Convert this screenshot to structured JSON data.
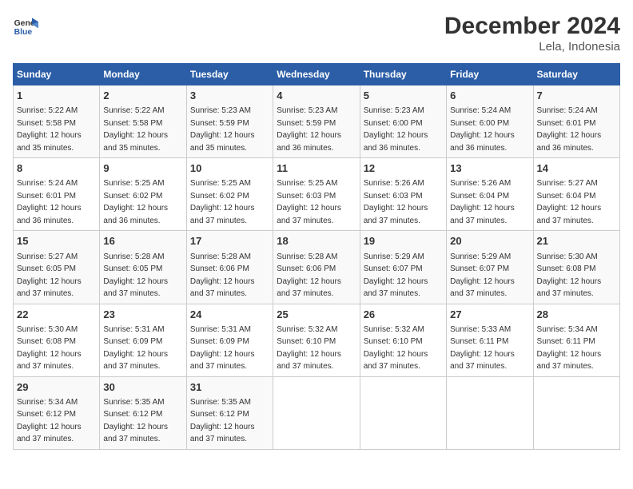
{
  "logo": {
    "line1": "General",
    "line2": "Blue"
  },
  "title": "December 2024",
  "subtitle": "Lela, Indonesia",
  "days_of_week": [
    "Sunday",
    "Monday",
    "Tuesday",
    "Wednesday",
    "Thursday",
    "Friday",
    "Saturday"
  ],
  "weeks": [
    [
      {
        "day": "1",
        "sunrise": "5:22 AM",
        "sunset": "5:58 PM",
        "daylight": "12 hours and 35 minutes."
      },
      {
        "day": "2",
        "sunrise": "5:22 AM",
        "sunset": "5:58 PM",
        "daylight": "12 hours and 35 minutes."
      },
      {
        "day": "3",
        "sunrise": "5:23 AM",
        "sunset": "5:59 PM",
        "daylight": "12 hours and 35 minutes."
      },
      {
        "day": "4",
        "sunrise": "5:23 AM",
        "sunset": "5:59 PM",
        "daylight": "12 hours and 36 minutes."
      },
      {
        "day": "5",
        "sunrise": "5:23 AM",
        "sunset": "6:00 PM",
        "daylight": "12 hours and 36 minutes."
      },
      {
        "day": "6",
        "sunrise": "5:24 AM",
        "sunset": "6:00 PM",
        "daylight": "12 hours and 36 minutes."
      },
      {
        "day": "7",
        "sunrise": "5:24 AM",
        "sunset": "6:01 PM",
        "daylight": "12 hours and 36 minutes."
      }
    ],
    [
      {
        "day": "8",
        "sunrise": "5:24 AM",
        "sunset": "6:01 PM",
        "daylight": "12 hours and 36 minutes."
      },
      {
        "day": "9",
        "sunrise": "5:25 AM",
        "sunset": "6:02 PM",
        "daylight": "12 hours and 36 minutes."
      },
      {
        "day": "10",
        "sunrise": "5:25 AM",
        "sunset": "6:02 PM",
        "daylight": "12 hours and 37 minutes."
      },
      {
        "day": "11",
        "sunrise": "5:25 AM",
        "sunset": "6:03 PM",
        "daylight": "12 hours and 37 minutes."
      },
      {
        "day": "12",
        "sunrise": "5:26 AM",
        "sunset": "6:03 PM",
        "daylight": "12 hours and 37 minutes."
      },
      {
        "day": "13",
        "sunrise": "5:26 AM",
        "sunset": "6:04 PM",
        "daylight": "12 hours and 37 minutes."
      },
      {
        "day": "14",
        "sunrise": "5:27 AM",
        "sunset": "6:04 PM",
        "daylight": "12 hours and 37 minutes."
      }
    ],
    [
      {
        "day": "15",
        "sunrise": "5:27 AM",
        "sunset": "6:05 PM",
        "daylight": "12 hours and 37 minutes."
      },
      {
        "day": "16",
        "sunrise": "5:28 AM",
        "sunset": "6:05 PM",
        "daylight": "12 hours and 37 minutes."
      },
      {
        "day": "17",
        "sunrise": "5:28 AM",
        "sunset": "6:06 PM",
        "daylight": "12 hours and 37 minutes."
      },
      {
        "day": "18",
        "sunrise": "5:28 AM",
        "sunset": "6:06 PM",
        "daylight": "12 hours and 37 minutes."
      },
      {
        "day": "19",
        "sunrise": "5:29 AM",
        "sunset": "6:07 PM",
        "daylight": "12 hours and 37 minutes."
      },
      {
        "day": "20",
        "sunrise": "5:29 AM",
        "sunset": "6:07 PM",
        "daylight": "12 hours and 37 minutes."
      },
      {
        "day": "21",
        "sunrise": "5:30 AM",
        "sunset": "6:08 PM",
        "daylight": "12 hours and 37 minutes."
      }
    ],
    [
      {
        "day": "22",
        "sunrise": "5:30 AM",
        "sunset": "6:08 PM",
        "daylight": "12 hours and 37 minutes."
      },
      {
        "day": "23",
        "sunrise": "5:31 AM",
        "sunset": "6:09 PM",
        "daylight": "12 hours and 37 minutes."
      },
      {
        "day": "24",
        "sunrise": "5:31 AM",
        "sunset": "6:09 PM",
        "daylight": "12 hours and 37 minutes."
      },
      {
        "day": "25",
        "sunrise": "5:32 AM",
        "sunset": "6:10 PM",
        "daylight": "12 hours and 37 minutes."
      },
      {
        "day": "26",
        "sunrise": "5:32 AM",
        "sunset": "6:10 PM",
        "daylight": "12 hours and 37 minutes."
      },
      {
        "day": "27",
        "sunrise": "5:33 AM",
        "sunset": "6:11 PM",
        "daylight": "12 hours and 37 minutes."
      },
      {
        "day": "28",
        "sunrise": "5:34 AM",
        "sunset": "6:11 PM",
        "daylight": "12 hours and 37 minutes."
      }
    ],
    [
      {
        "day": "29",
        "sunrise": "5:34 AM",
        "sunset": "6:12 PM",
        "daylight": "12 hours and 37 minutes."
      },
      {
        "day": "30",
        "sunrise": "5:35 AM",
        "sunset": "6:12 PM",
        "daylight": "12 hours and 37 minutes."
      },
      {
        "day": "31",
        "sunrise": "5:35 AM",
        "sunset": "6:12 PM",
        "daylight": "12 hours and 37 minutes."
      },
      null,
      null,
      null,
      null
    ]
  ]
}
